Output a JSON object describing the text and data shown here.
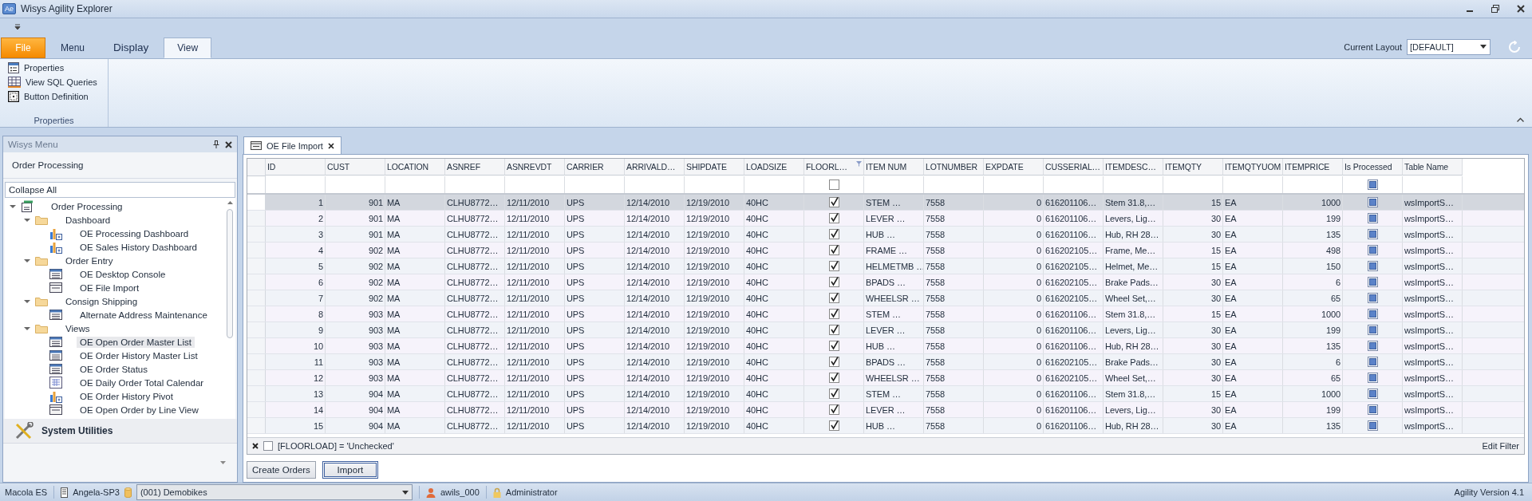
{
  "window": {
    "logo": "Ae",
    "title": "Wisys Agility Explorer"
  },
  "ribbon": {
    "tabs": [
      {
        "label": "File",
        "kind": "file",
        "selected": false
      },
      {
        "label": "Menu",
        "kind": "tab",
        "selected": false
      },
      {
        "label": "Display",
        "kind": "tab",
        "selected": false
      },
      {
        "label": "View",
        "kind": "tab",
        "selected": true
      }
    ],
    "items": [
      {
        "label": "Properties",
        "kind": "properties"
      },
      {
        "label": "View SQL Queries",
        "kind": "sql"
      },
      {
        "label": "Button Definition",
        "kind": "button"
      }
    ],
    "group_label": "Properties",
    "layout_label": "Current Layout",
    "layout_value": "[DEFAULT]"
  },
  "sidebar": {
    "title": "Wisys Menu",
    "group": "Order Processing",
    "collapse_all": "Collapse All",
    "tree": [
      {
        "label": "Order Processing",
        "kind": "app",
        "expanded": true,
        "selected": false,
        "children": [
          {
            "label": "Dashboard",
            "kind": "folder",
            "expanded": true,
            "selected": false,
            "children": [
              {
                "label": "OE Processing Dashboard",
                "kind": "dashboard",
                "selected": false
              },
              {
                "label": "OE Sales History Dashboard",
                "kind": "dashboard",
                "selected": false
              }
            ]
          },
          {
            "label": "Order Entry",
            "kind": "folder",
            "expanded": true,
            "selected": false,
            "children": [
              {
                "label": "OE Desktop Console",
                "kind": "grid",
                "selected": false
              },
              {
                "label": "OE File Import",
                "kind": "form",
                "selected": false
              }
            ]
          },
          {
            "label": "Consign Shipping",
            "kind": "folder",
            "expanded": true,
            "selected": false,
            "children": [
              {
                "label": "Alternate Address Maintenance",
                "kind": "grid",
                "selected": false
              }
            ]
          },
          {
            "label": "Views",
            "kind": "folder",
            "expanded": true,
            "selected": false,
            "children": [
              {
                "label": "OE Open Order Master List",
                "kind": "grid",
                "selected": true
              },
              {
                "label": "OE Order History Master List",
                "kind": "grid",
                "selected": false
              },
              {
                "label": "OE Order Status",
                "kind": "grid",
                "selected": false
              },
              {
                "label": "OE Daily Order Total Calendar",
                "kind": "calendar",
                "selected": false
              },
              {
                "label": "OE Order History Pivot",
                "kind": "dashboard",
                "selected": false
              },
              {
                "label": "OE Open Order by Line View",
                "kind": "form",
                "selected": false
              }
            ]
          }
        ]
      }
    ],
    "section": "System Utilities"
  },
  "document_tab": {
    "label": "OE File Import",
    "selected": true
  },
  "table": {
    "columns": [
      {
        "label": "ID",
        "kind": "number"
      },
      {
        "label": "CUST",
        "kind": "number"
      },
      {
        "label": "LOCATION",
        "kind": "text"
      },
      {
        "label": "ASNREF",
        "kind": "text"
      },
      {
        "label": "ASNREVDT",
        "kind": "text"
      },
      {
        "label": "CARRIER",
        "kind": "text"
      },
      {
        "label": "ARRIVALD…",
        "kind": "text"
      },
      {
        "label": "SHIPDATE",
        "kind": "text"
      },
      {
        "label": "LOADSIZE",
        "kind": "text"
      },
      {
        "label": "FLOORL…",
        "kind": "check",
        "filtered": true,
        "filter_checked": false
      },
      {
        "label": "ITEM NUM",
        "kind": "text"
      },
      {
        "label": "LOTNUMBER",
        "kind": "text"
      },
      {
        "label": "EXPDATE",
        "kind": "number"
      },
      {
        "label": "CUSSERIAL…",
        "kind": "text"
      },
      {
        "label": "ITEMDESC…",
        "kind": "text"
      },
      {
        "label": "ITEMQTY",
        "kind": "number"
      },
      {
        "label": "ITEMQTYUOM",
        "kind": "text"
      },
      {
        "label": "ITEMPRICE",
        "kind": "number"
      },
      {
        "label": "Is Processed",
        "kind": "tristate",
        "filter_indeterminate": true
      },
      {
        "label": "Table Name",
        "kind": "text"
      }
    ],
    "rows": [
      {
        "selected": true,
        "cells": [
          "1",
          "901",
          "MA",
          "CLHU8772…",
          "12/11/2010",
          "UPS",
          "12/14/2010",
          "12/19/2010",
          "40HC",
          {
            "checked": true
          },
          "STEM …",
          "7558",
          "0",
          "616201106…",
          "Stem 31.8,…",
          "15",
          "EA",
          "1000",
          {
            "indeterminate": true
          },
          "wsImportS…"
        ]
      },
      {
        "selected": false,
        "cells": [
          "2",
          "901",
          "MA",
          "CLHU8772…",
          "12/11/2010",
          "UPS",
          "12/14/2010",
          "12/19/2010",
          "40HC",
          {
            "checked": true
          },
          "LEVER …",
          "7558",
          "0",
          "616201106…",
          "Levers, Lig…",
          "30",
          "EA",
          "199",
          {
            "indeterminate": true
          },
          "wsImportS…"
        ]
      },
      {
        "selected": false,
        "cells": [
          "3",
          "901",
          "MA",
          "CLHU8772…",
          "12/11/2010",
          "UPS",
          "12/14/2010",
          "12/19/2010",
          "40HC",
          {
            "checked": true
          },
          "HUB …",
          "7558",
          "0",
          "616201106…",
          "Hub, RH 28…",
          "30",
          "EA",
          "135",
          {
            "indeterminate": true
          },
          "wsImportS…"
        ]
      },
      {
        "selected": false,
        "cells": [
          "4",
          "902",
          "MA",
          "CLHU8772…",
          "12/11/2010",
          "UPS",
          "12/14/2010",
          "12/19/2010",
          "40HC",
          {
            "checked": true
          },
          "FRAME …",
          "7558",
          "0",
          "616202105…",
          "Frame, Me…",
          "15",
          "EA",
          "498",
          {
            "indeterminate": true
          },
          "wsImportS…"
        ]
      },
      {
        "selected": false,
        "cells": [
          "5",
          "902",
          "MA",
          "CLHU8772…",
          "12/11/2010",
          "UPS",
          "12/14/2010",
          "12/19/2010",
          "40HC",
          {
            "checked": true
          },
          "HELMETMB …",
          "7558",
          "0",
          "616202105…",
          "Helmet, Me…",
          "15",
          "EA",
          "150",
          {
            "indeterminate": true
          },
          "wsImportS…"
        ]
      },
      {
        "selected": false,
        "cells": [
          "6",
          "902",
          "MA",
          "CLHU8772…",
          "12/11/2010",
          "UPS",
          "12/14/2010",
          "12/19/2010",
          "40HC",
          {
            "checked": true
          },
          "BPADS …",
          "7558",
          "0",
          "616202105…",
          "Brake Pads…",
          "30",
          "EA",
          "6",
          {
            "indeterminate": true
          },
          "wsImportS…"
        ]
      },
      {
        "selected": false,
        "cells": [
          "7",
          "902",
          "MA",
          "CLHU8772…",
          "12/11/2010",
          "UPS",
          "12/14/2010",
          "12/19/2010",
          "40HC",
          {
            "checked": true
          },
          "WHEELSR …",
          "7558",
          "0",
          "616202105…",
          "Wheel Set,…",
          "30",
          "EA",
          "65",
          {
            "indeterminate": true
          },
          "wsImportS…"
        ]
      },
      {
        "selected": false,
        "cells": [
          "8",
          "903",
          "MA",
          "CLHU8772…",
          "12/11/2010",
          "UPS",
          "12/14/2010",
          "12/19/2010",
          "40HC",
          {
            "checked": true
          },
          "STEM …",
          "7558",
          "0",
          "616201106…",
          "Stem 31.8,…",
          "15",
          "EA",
          "1000",
          {
            "indeterminate": true
          },
          "wsImportS…"
        ]
      },
      {
        "selected": false,
        "cells": [
          "9",
          "903",
          "MA",
          "CLHU8772…",
          "12/11/2010",
          "UPS",
          "12/14/2010",
          "12/19/2010",
          "40HC",
          {
            "checked": true
          },
          "LEVER …",
          "7558",
          "0",
          "616201106…",
          "Levers, Lig…",
          "30",
          "EA",
          "199",
          {
            "indeterminate": true
          },
          "wsImportS…"
        ]
      },
      {
        "selected": false,
        "cells": [
          "10",
          "903",
          "MA",
          "CLHU8772…",
          "12/11/2010",
          "UPS",
          "12/14/2010",
          "12/19/2010",
          "40HC",
          {
            "checked": true
          },
          "HUB …",
          "7558",
          "0",
          "616201106…",
          "Hub, RH 28…",
          "30",
          "EA",
          "135",
          {
            "indeterminate": true
          },
          "wsImportS…"
        ]
      },
      {
        "selected": false,
        "cells": [
          "11",
          "903",
          "MA",
          "CLHU8772…",
          "12/11/2010",
          "UPS",
          "12/14/2010",
          "12/19/2010",
          "40HC",
          {
            "checked": true
          },
          "BPADS …",
          "7558",
          "0",
          "616202105…",
          "Brake Pads…",
          "30",
          "EA",
          "6",
          {
            "indeterminate": true
          },
          "wsImportS…"
        ]
      },
      {
        "selected": false,
        "cells": [
          "12",
          "903",
          "MA",
          "CLHU8772…",
          "12/11/2010",
          "UPS",
          "12/14/2010",
          "12/19/2010",
          "40HC",
          {
            "checked": true
          },
          "WHEELSR …",
          "7558",
          "0",
          "616202105…",
          "Wheel Set,…",
          "30",
          "EA",
          "65",
          {
            "indeterminate": true
          },
          "wsImportS…"
        ]
      },
      {
        "selected": false,
        "cells": [
          "13",
          "904",
          "MA",
          "CLHU8772…",
          "12/11/2010",
          "UPS",
          "12/14/2010",
          "12/19/2010",
          "40HC",
          {
            "checked": true
          },
          "STEM …",
          "7558",
          "0",
          "616201106…",
          "Stem 31.8,…",
          "15",
          "EA",
          "1000",
          {
            "indeterminate": true
          },
          "wsImportS…"
        ]
      },
      {
        "selected": false,
        "cells": [
          "14",
          "904",
          "MA",
          "CLHU8772…",
          "12/11/2010",
          "UPS",
          "12/14/2010",
          "12/19/2010",
          "40HC",
          {
            "checked": true
          },
          "LEVER …",
          "7558",
          "0",
          "616201106…",
          "Levers, Lig…",
          "30",
          "EA",
          "199",
          {
            "indeterminate": true
          },
          "wsImportS…"
        ]
      },
      {
        "selected": false,
        "cells": [
          "15",
          "904",
          "MA",
          "CLHU8772…",
          "12/11/2010",
          "UPS",
          "12/14/2010",
          "12/19/2010",
          "40HC",
          {
            "checked": true
          },
          "HUB …",
          "7558",
          "0",
          "616201106…",
          "Hub, RH 28…",
          "30",
          "EA",
          "135",
          {
            "indeterminate": true
          },
          "wsImportS…"
        ]
      }
    ],
    "filter_bar": {
      "enabled": false,
      "text": "[FLOORLOAD] = 'Unchecked'",
      "edit": "Edit Filter"
    }
  },
  "buttons": [
    {
      "label": "Create Orders",
      "focused": false
    },
    {
      "label": "Import",
      "focused": true
    }
  ],
  "status_bar": {
    "product": "Macola ES",
    "server": "Angela-SP3",
    "company": "(001) Demobikes",
    "user": "awils_000",
    "role": "Administrator",
    "version": "Agility Version 4.1"
  }
}
